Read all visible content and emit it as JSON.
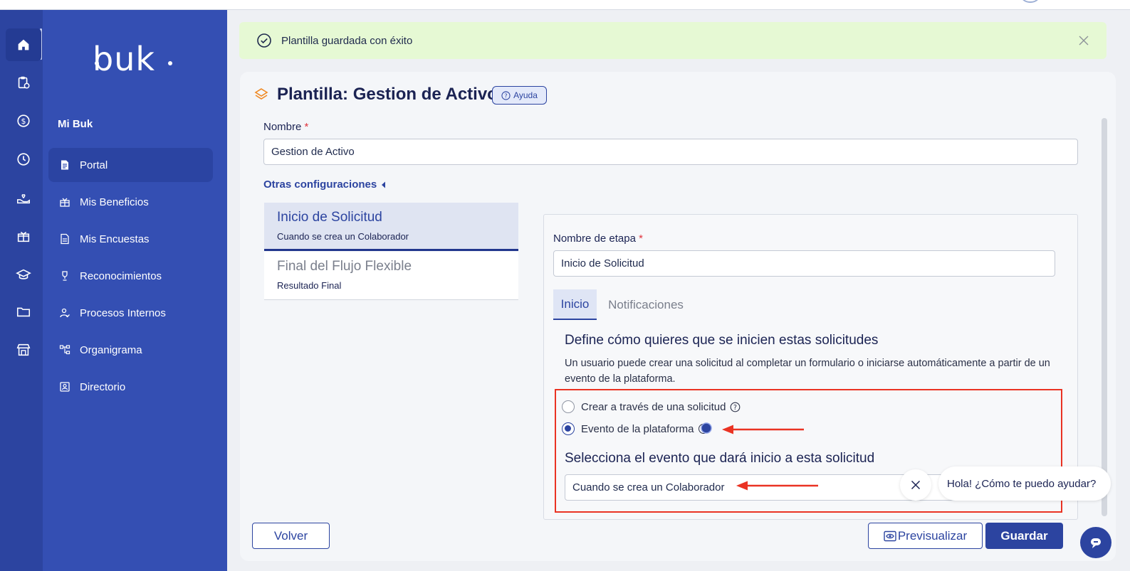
{
  "brand": {
    "logo_text": "buk"
  },
  "sidebar": {
    "section_title": "Mi Buk",
    "items": [
      {
        "label": "Portal",
        "icon": "document-icon",
        "active": true
      },
      {
        "label": "Mis Beneficios",
        "icon": "gift-icon",
        "active": false
      },
      {
        "label": "Mis Encuestas",
        "icon": "file-icon",
        "active": false
      },
      {
        "label": "Reconocimientos",
        "icon": "trophy-icon",
        "active": false
      },
      {
        "label": "Procesos Internos",
        "icon": "user-check-icon",
        "active": false
      },
      {
        "label": "Organigrama",
        "icon": "org-chart-icon",
        "active": false
      },
      {
        "label": "Directorio",
        "icon": "contact-card-icon",
        "active": false
      }
    ]
  },
  "rail": {
    "icons": [
      "home-icon",
      "clipboard-icon",
      "dollar-icon",
      "clock-icon",
      "hand-heart-icon",
      "gift-box-icon",
      "graduation-cap-icon",
      "folder-icon",
      "store-icon"
    ]
  },
  "toast": {
    "message": "Plantilla guardada con éxito",
    "icon": "check-circle-icon",
    "bg": "#e6f9d4"
  },
  "page": {
    "title": "Plantilla: Gestion de Activo",
    "help_label": "Ayuda",
    "name_label": "Nombre",
    "name_value": "Gestion de Activo",
    "otras_label": "Otras configuraciones"
  },
  "stages": [
    {
      "title": "Inicio de Solicitud",
      "subtitle": "Cuando se crea un Colaborador",
      "active": true
    },
    {
      "title": "Final del Flujo Flexible",
      "subtitle": "Resultado Final",
      "active": false
    }
  ],
  "stage_detail": {
    "name_label": "Nombre de etapa",
    "name_value": "Inicio de Solicitud",
    "tabs": [
      "Inicio",
      "Notificaciones"
    ],
    "heading": "Define cómo quieres que se inicien estas solicitudes",
    "description": "Un usuario puede crear una solicitud al completar un formulario o iniciarse automáticamente a partir de un evento de la plataforma.",
    "options": [
      {
        "label": "Crear a través de una solicitud",
        "selected": false
      },
      {
        "label": "Evento de la plataforma",
        "selected": true
      }
    ],
    "event_heading": "Selecciona el evento que dará inicio a esta solicitud",
    "event_value": "Cuando se crea un Colaborador"
  },
  "chat": {
    "message": "Hola! ¿Cómo te puedo ayudar?"
  },
  "footer": {
    "back_label": "Volver",
    "preview_label": "Previsualizar",
    "save_label": "Guardar"
  },
  "colors": {
    "primary": "#2c44a0",
    "sidebar": "#344fb3",
    "rail": "#2c44a0",
    "annotation": "#ea3323",
    "required": "#e0353e"
  }
}
